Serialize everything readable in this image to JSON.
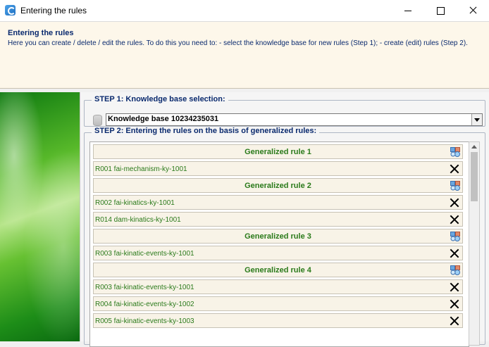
{
  "window": {
    "title": "Entering the rules"
  },
  "header": {
    "title": "Entering the rules",
    "description": "Here you can create / delete / edit the rules. To do this you need to: - select the knowledge base for new rules (Step 1); - create (edit) rules (Step 2)."
  },
  "step1": {
    "label": "STEP 1: Knowledge base selection:",
    "selected_kb": "Knowledge base 10234235031"
  },
  "step2": {
    "label": "STEP 2: Entering the rules on the basis of generalized rules:",
    "rows": [
      {
        "type": "head",
        "text": "Generalized rule 1"
      },
      {
        "type": "rule",
        "text": "R001 fai-mechanism-ky-1001"
      },
      {
        "type": "head",
        "text": "Generalized rule 2"
      },
      {
        "type": "rule",
        "text": "R002 fai-kinatics-ky-1001"
      },
      {
        "type": "rule",
        "text": "R014 dam-kinatics-ky-1001"
      },
      {
        "type": "head",
        "text": "Generalized rule 3"
      },
      {
        "type": "rule",
        "text": "R003 fai-kinatic-events-ky-1001"
      },
      {
        "type": "head",
        "text": "Generalized rule 4"
      },
      {
        "type": "rule",
        "text": "R003 fai-kinatic-events-ky-1001"
      },
      {
        "type": "rule",
        "text": "R004 fai-kinatic-events-ky-1002"
      },
      {
        "type": "rule",
        "text": "R005 fai-kinatic-events-ky-1003"
      }
    ]
  },
  "icons": {
    "app": "app-icon",
    "config": "rule-settings-icon",
    "delete": "delete-icon",
    "database": "database-icon"
  },
  "colors": {
    "header_bg": "#fdf7ea",
    "title_blue": "#0a2a6e",
    "rule_green": "#2a7a1a",
    "row_bg": "#f8f3e7"
  }
}
